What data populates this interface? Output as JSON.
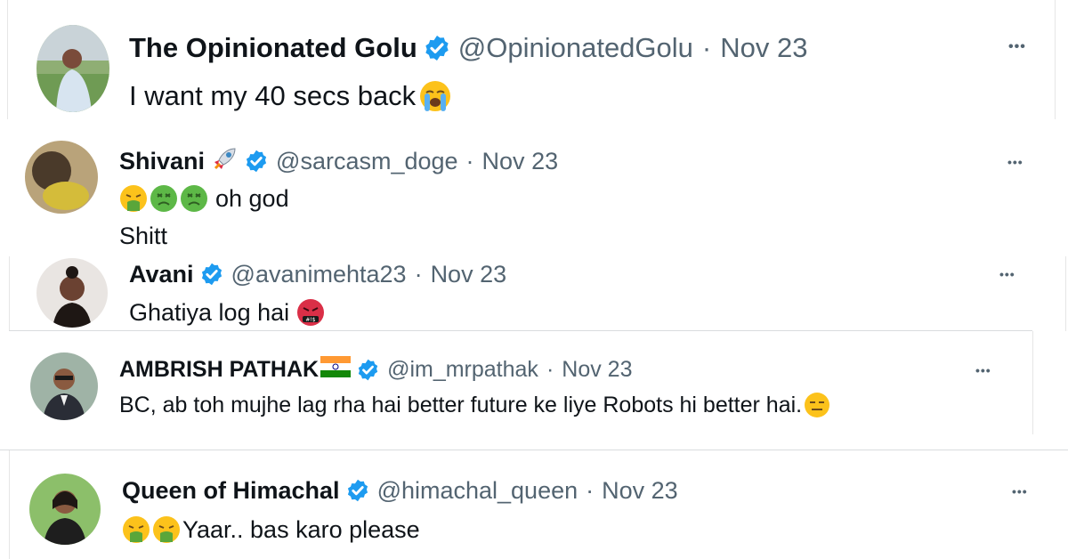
{
  "tweets": [
    {
      "name": "The Opinionated Golu",
      "handle": "@OpinionatedGolu",
      "sep": "·",
      "date": "Nov 23",
      "more": "•••",
      "text": "I want my 40 secs back",
      "emoji": "loudly-crying-face"
    },
    {
      "name": "Shivani",
      "handle": "@sarcasm_doge",
      "sep": "·",
      "date": "Nov 23",
      "more": "•••",
      "badge_emoji": "rocket",
      "line1": "oh god",
      "line2": "Shitt",
      "emoji": [
        "vomiting-face",
        "nauseated-face",
        "nauseated-face"
      ]
    },
    {
      "name": "Avani",
      "handle": "@avanimehta23",
      "sep": "·",
      "date": "Nov 23",
      "more": "•••",
      "text": "Ghatiya log hai",
      "emoji": "face-with-symbols-on-mouth"
    },
    {
      "name": "AMBRISH PATHAK",
      "handle": "@im_mrpathak",
      "sep": "·",
      "date": "Nov 23",
      "more": "•••",
      "badge_emoji": "india-flag",
      "text": "BC, ab toh mujhe lag rha hai better future ke liye Robots hi better hai.",
      "emoji": "expressionless-face"
    },
    {
      "name": "Queen of Himachal",
      "handle": "@himachal_queen",
      "sep": "·",
      "date": "Nov 23",
      "more": "•••",
      "text": "Yaar.. bas karo please",
      "emoji": [
        "vomiting-face",
        "vomiting-face"
      ]
    }
  ],
  "colors": {
    "verified": "#1d9bf0",
    "muted": "#536471",
    "text": "#0f1419",
    "divider": "#d9dcde"
  }
}
